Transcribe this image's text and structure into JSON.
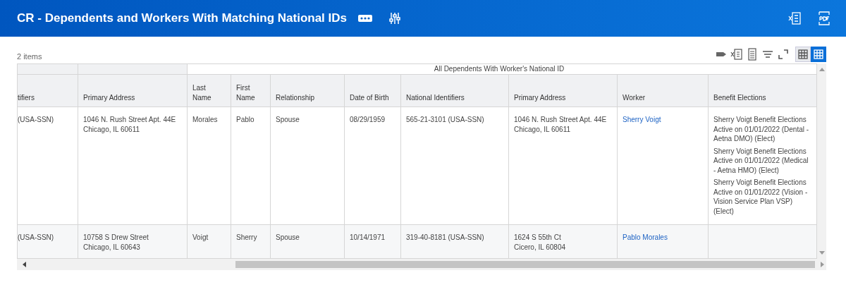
{
  "header": {
    "title": "CR - Dependents and Workers With Matching National IDs"
  },
  "item_count": "2 items",
  "view_toggle": [
    {
      "selected": false
    },
    {
      "selected": true
    }
  ],
  "table": {
    "columns": [
      {
        "label": "tifiers"
      },
      {
        "label": "Primary Address"
      }
    ],
    "group": {
      "label": "All Dependents With Worker's National ID",
      "columns": [
        {
          "label": "Last Name"
        },
        {
          "label": "First Name"
        },
        {
          "label": "Relationship"
        },
        {
          "label": "Date of Birth"
        },
        {
          "label": "National Identifiers"
        },
        {
          "label": "Primary Address"
        },
        {
          "label": "Worker"
        },
        {
          "label": "Benefit Elections"
        }
      ]
    },
    "rows": [
      {
        "cells": [
          {
            "kind": "text",
            "text": "(USA-SSN)"
          },
          {
            "kind": "text",
            "lines": [
              "1046 N. Rush Street  Apt. 44E",
              "Chicago, IL 60611"
            ]
          },
          {
            "kind": "text",
            "text": "Morales"
          },
          {
            "kind": "text",
            "text": "Pablo"
          },
          {
            "kind": "text",
            "text": "Spouse"
          },
          {
            "kind": "text",
            "text": "08/29/1959"
          },
          {
            "kind": "text",
            "text": "565-21-3101 (USA-SSN)"
          },
          {
            "kind": "text",
            "lines": [
              "1046 N. Rush Street  Apt. 44E",
              "Chicago, IL 60611"
            ]
          },
          {
            "kind": "link",
            "text": "Sherry Voigt"
          },
          {
            "kind": "list",
            "items": [
              "Sherry Voigt Benefit Elections Active on 01/01/2022 (Dental - Aetna DMO) (Elect)",
              "Sherry Voigt Benefit Elections Active on 01/01/2022 (Medical - Aetna HMO) (Elect)",
              "Sherry Voigt Benefit Elections Active on 01/01/2022 (Vision - Vision Service Plan VSP) (Elect)"
            ]
          }
        ]
      },
      {
        "cells": [
          {
            "kind": "text",
            "text": "(USA-SSN)"
          },
          {
            "kind": "text",
            "lines": [
              "10758 S Drew Street",
              "Chicago, IL 60643"
            ]
          },
          {
            "kind": "text",
            "text": "Voigt"
          },
          {
            "kind": "text",
            "text": "Sherry"
          },
          {
            "kind": "text",
            "text": "Spouse"
          },
          {
            "kind": "text",
            "text": "10/14/1971"
          },
          {
            "kind": "text",
            "text": "319-40-8181 (USA-SSN)"
          },
          {
            "kind": "text",
            "lines": [
              "1624 S 55th Ct",
              "Cicero, IL 60804"
            ]
          },
          {
            "kind": "link",
            "text": "Pablo Morales"
          }
        ]
      }
    ]
  }
}
